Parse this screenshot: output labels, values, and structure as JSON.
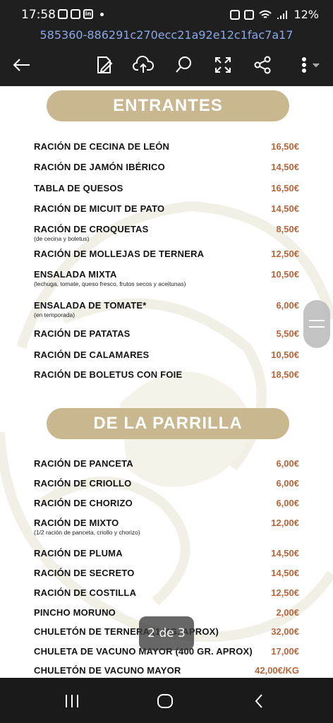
{
  "status": {
    "time": "17:58",
    "battery": "12%"
  },
  "document": {
    "title": "585360-886291c270ecc21a92e12c1fac7a17"
  },
  "toolbar": {
    "back": "back-arrow-icon",
    "edit": "edit-icon",
    "upload": "cloud-upload-icon",
    "search": "search-icon",
    "fullscreen": "fullscreen-icon",
    "share": "share-icon",
    "more": "more-icon"
  },
  "sections": [
    {
      "title": "ENTRANTES",
      "items": [
        {
          "name": "RACIÓN DE CECINA DE LEÓN",
          "price": "16,50€"
        },
        {
          "name": "RACIÓN DE JAMÓN IBÉRICO",
          "price": "14,50€"
        },
        {
          "name": "TABLA DE QUESOS",
          "price": "16,50€"
        },
        {
          "name": "RACIÓN DE MICUIT DE PATO",
          "price": "14,50€"
        },
        {
          "name": "RACIÓN DE CROQUETAS",
          "note": "(de cecina y boletus)",
          "price": "8,50€"
        },
        {
          "name": "RACIÓN DE MOLLEJAS DE TERNERA",
          "price": "12,50€"
        },
        {
          "name": "ENSALADA  MIXTA",
          "note": "(lechuga,  tomate,  queso  fresco, frutos secos y aceitunas)",
          "price": "10,50€"
        },
        {
          "name": "ENSALADA DE TOMATE*",
          "note": "(en temporada)",
          "price": "6,00€"
        },
        {
          "name": "RACIÓN DE PATATAS",
          "price": "5,50€"
        },
        {
          "name": "RACIÓN DE CALAMARES",
          "price": "10,50€"
        },
        {
          "name": "RACIÓN DE BOLETUS CON FOIE",
          "price": "18,50€"
        }
      ]
    },
    {
      "title": "DE LA PARRILLA",
      "items": [
        {
          "name": "RACIÓN DE PANCETA",
          "price": "6,00€"
        },
        {
          "name": "RACIÓN DE CRIOLLO",
          "price": "6,00€"
        },
        {
          "name": "RACIÓN DE CHORIZO",
          "price": "6,00€"
        },
        {
          "name": "RACIÓN DE MIXTO",
          "note": "(1/2 ración de panceta, criollo y chorizo)",
          "price": "12,00€"
        },
        {
          "name": "RACIÓN DE PLUMA",
          "price": "14,50€"
        },
        {
          "name": "RACIÓN DE SECRETO",
          "price": "14,50€"
        },
        {
          "name": "RACIÓN DE COSTILLA",
          "price": "12,50€"
        },
        {
          "name": "PINCHO MORUNO",
          "price": "2,00€"
        },
        {
          "name": "CHULETÓN DE TERNERA (1 KG. APROX)",
          "price": "32,00€"
        },
        {
          "name": "CHULETA DE VACUNO MAYOR (400 GR. APROX)",
          "price": "17,00€"
        },
        {
          "name": "CHULETÓN DE VACUNO MAYOR",
          "price": "42,00€/KG"
        }
      ]
    }
  ],
  "page_indicator": "2 de 3",
  "colors": {
    "pill": "#c8b78f",
    "price": "#b7653a",
    "bar": "#1f1f1f"
  }
}
